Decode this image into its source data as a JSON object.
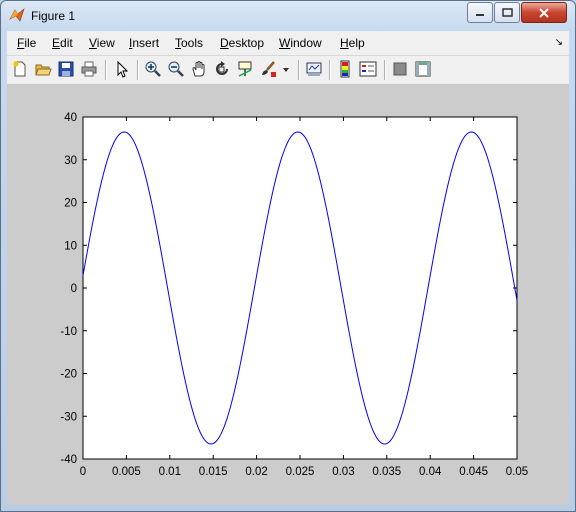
{
  "window": {
    "title": "Figure 1"
  },
  "menu": {
    "file": {
      "u": "F",
      "rest": "ile"
    },
    "edit": {
      "u": "E",
      "rest": "dit"
    },
    "view": {
      "u": "V",
      "rest": "iew"
    },
    "insert": {
      "u": "I",
      "rest": "nsert"
    },
    "tools": {
      "u": "T",
      "rest": "ools"
    },
    "desktop": {
      "u": "D",
      "rest": "esktop"
    },
    "window": {
      "u": "W",
      "rest": "indow"
    },
    "help": {
      "u": "H",
      "rest": "elp"
    }
  },
  "toolbar_icons": [
    "new-figure-icon",
    "open-file-icon",
    "save-icon",
    "print-icon",
    "edit-plot-arrow-icon",
    "zoom-in-icon",
    "zoom-out-icon",
    "pan-hand-icon",
    "rotate-3d-icon",
    "data-cursor-icon",
    "brush-icon",
    "link-plot-icon",
    "colorbar-icon",
    "legend-icon",
    "hide-plot-tools-icon",
    "show-plot-tools-icon"
  ],
  "chart_data": {
    "type": "line",
    "xlim": [
      0,
      0.05
    ],
    "ylim": [
      -40,
      40
    ],
    "x_ticks": [
      "0",
      "0.005",
      "0.01",
      "0.015",
      "0.02",
      "0.025",
      "0.03",
      "0.035",
      "0.04",
      "0.045",
      "0.05"
    ],
    "y_ticks": [
      "40",
      "30",
      "20",
      "10",
      "0",
      "-10",
      "-20",
      "-30",
      "-40"
    ],
    "series": [
      {
        "color": "#0000ff",
        "function": "y = 36.5*sin(2*pi*50*x + 0.08)",
        "x_start": 0,
        "x_end": 0.05,
        "amplitude": 36.5,
        "frequency_hz": 50,
        "phase_rad": 0.08
      }
    ],
    "grid": false
  }
}
